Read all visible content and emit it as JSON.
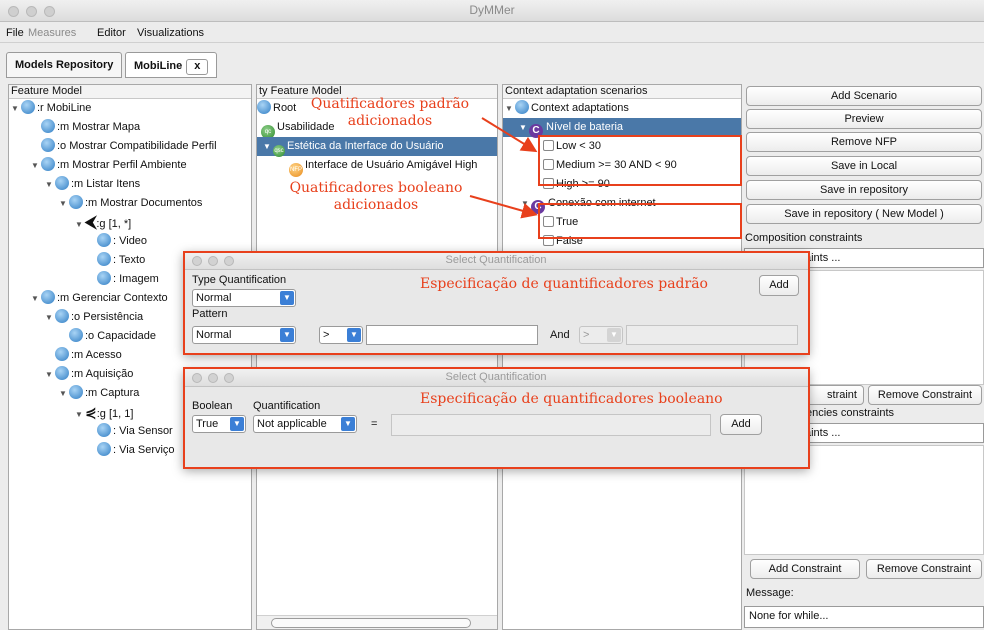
{
  "window": {
    "title": "DyMMer"
  },
  "menu": [
    "File",
    "Measures",
    "Editor",
    "Visualizations"
  ],
  "tabs": [
    {
      "label": "Models Repository"
    },
    {
      "label": "MobiLine",
      "close": "x"
    }
  ],
  "feature_model": {
    "header": "Feature Model",
    "items": [
      ":r MobiLine",
      ":m Mostrar Mapa",
      ":o Mostrar Compatibilidade Perfil",
      ":m Mostrar Perfil Ambiente",
      ":m Listar Itens",
      ":m Mostrar Documentos",
      ":g [1, *]",
      ": Video",
      ": Texto",
      ": Imagem",
      ":m Gerenciar Contexto",
      ":o Persistência",
      ":o Capacidade",
      ":m Acesso",
      ":m Aquisição",
      ":m Captura",
      ":g [1, 1]",
      ": Via Sensor",
      ": Via Serviço"
    ]
  },
  "quality_model": {
    "header": "ty Feature Model",
    "items": [
      "Root",
      "Usabilidade",
      "Estética da Interface do Usuário",
      "Interface de Usuário Amigável High"
    ],
    "icon_labels": {
      "qc": "qc",
      "qsc": "qsc",
      "nfp": "NFP"
    }
  },
  "context": {
    "header": "Context adaptation scenarios",
    "root": "Context adaptations",
    "c_letter": "C",
    "groups": [
      {
        "name": "Nível de bateria",
        "items": [
          "Low < 30",
          "Medium >= 30 AND < 90",
          "High >= 90"
        ]
      },
      {
        "name": "Conexão com internet",
        "items": [
          "True",
          "False"
        ]
      }
    ]
  },
  "right_panel": {
    "buttons": [
      "Add Scenario",
      "Preview",
      "Remove NFP",
      "Save in Local",
      "Save in repository",
      "Save in repository ( New Model )"
    ],
    "composition_header": "Composition constraints",
    "constraints_placeholder": "aints ...",
    "add_constraint": "Add Constraint",
    "add_constraint_partial": "straint",
    "remove_constraint": "Remove Constraint",
    "dependencies_header": "encies constraints",
    "constraints_placeholder2": "aints ...",
    "message_label": "Message:",
    "message_value": "None for while..."
  },
  "dialog_standard": {
    "title": "Select Quantification",
    "type_label": "Type Quantification",
    "type_value": "Normal",
    "pattern_label": "Pattern",
    "pattern_value": "Normal",
    "operator": ">",
    "and_label": "And",
    "operator2": ">",
    "add": "Add",
    "annotation": "Especificação de quantificadores padrão"
  },
  "dialog_boolean": {
    "title": "Select Quantification",
    "boolean_label": "Boolean",
    "boolean_value": "True",
    "quant_label": "Quantification",
    "quant_value": "Not applicable",
    "equals": "=",
    "add": "Add",
    "annotation": "Especificação de quantificadores booleano"
  },
  "annotations": {
    "standard_added_1": "Quatificadores padrão",
    "standard_added_2": "adicionados",
    "boolean_added_1": "Quatificadores booleano",
    "boolean_added_2": "adicionados"
  },
  "colors": {
    "annotation": "#e8401c",
    "selection": "#4a78a8",
    "combo_arrow": "#3b7fd6"
  }
}
